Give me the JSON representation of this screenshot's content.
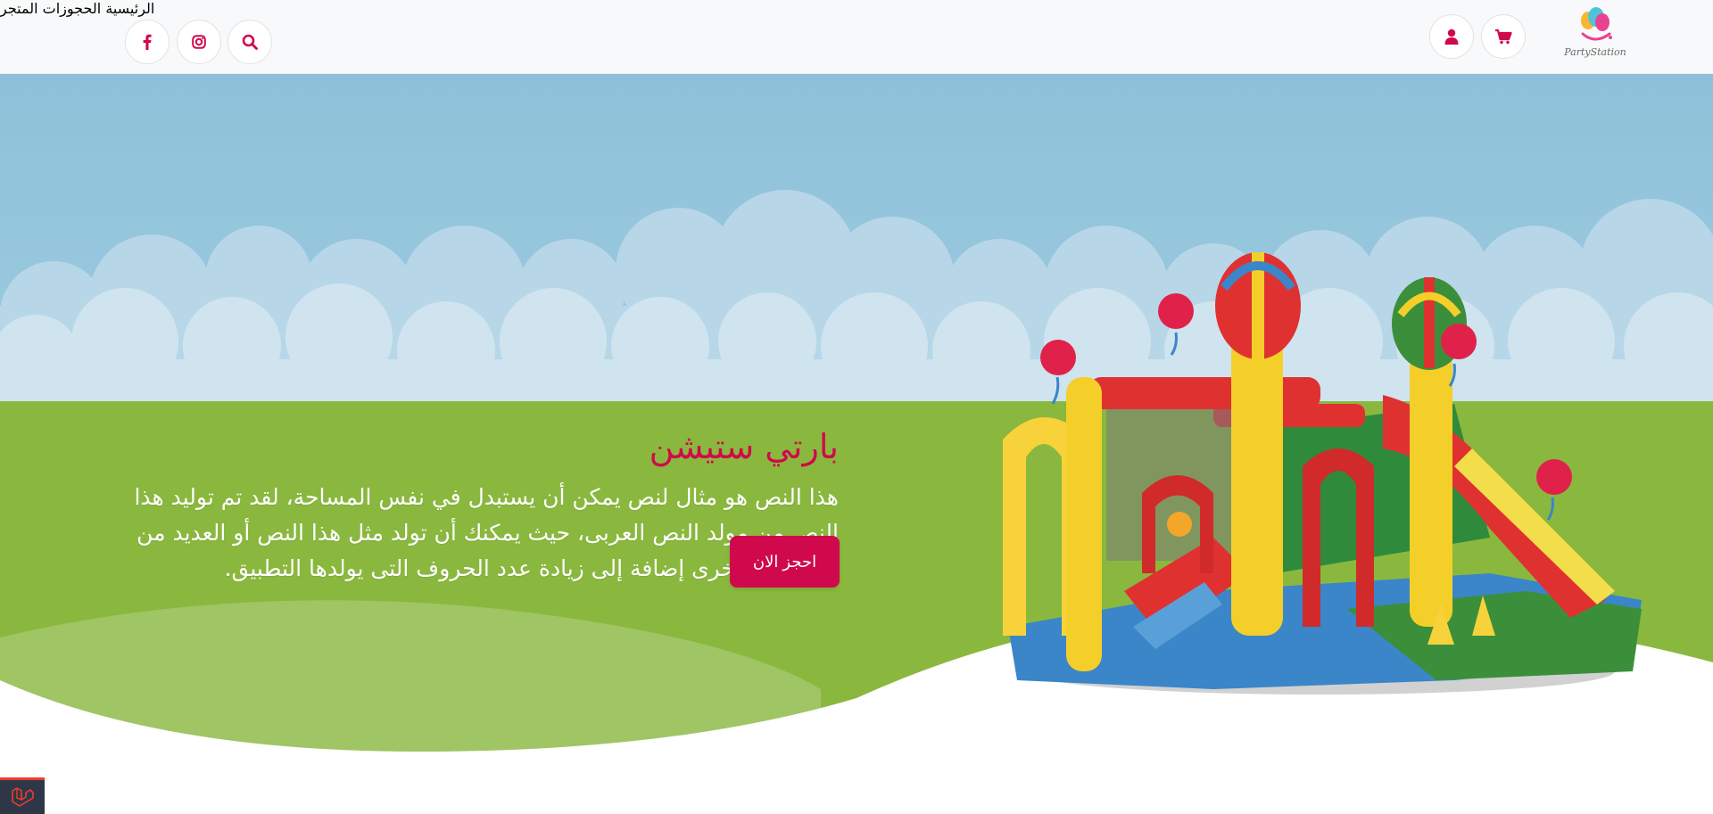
{
  "header": {
    "logo": {
      "text": "PartyStation",
      "icon": "balloons-logo"
    },
    "nav": [
      {
        "label": "الرئيسية"
      },
      {
        "label": "الحجوزات"
      },
      {
        "label": "المتجر"
      }
    ],
    "actions": [
      {
        "icon": "cart-icon"
      },
      {
        "icon": "user-icon"
      }
    ],
    "social": [
      {
        "icon": "search-icon"
      },
      {
        "icon": "instagram-icon"
      },
      {
        "icon": "facebook-icon"
      }
    ]
  },
  "hero": {
    "title": "بارتي ستيشن",
    "description": "هذا النص هو مثال لنص يمكن أن يستبدل في نفس المساحة، لقد تم توليد هذا النص من مولد النص العربى، حيث يمكنك أن تولد مثل هذا النص أو العديد من النصوص الأخرى إضافة إلى زيادة عدد الحروف التى يولدها التطبيق.",
    "cta": "احجز الان",
    "image": "bouncy-castle-illustration"
  },
  "colors": {
    "accent": "#d0094c",
    "sky": "#8ec1d9",
    "grass": "#8ab83e",
    "header_bg": "#f8f9fa"
  },
  "footer_badge": {
    "icon": "laravel-icon"
  }
}
